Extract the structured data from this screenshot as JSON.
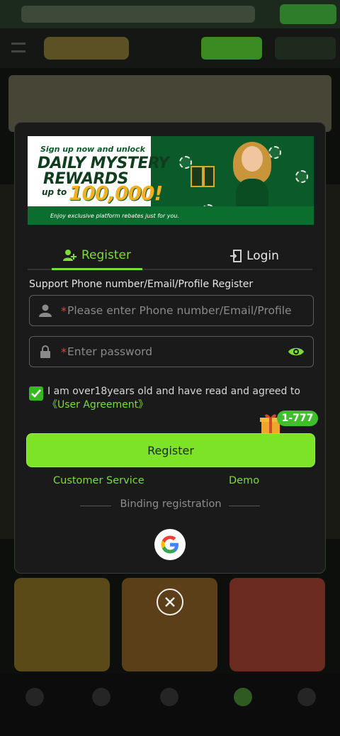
{
  "promo": {
    "line1": "Sign up now and unlock",
    "line2": "DAILY MYSTERY",
    "line3": "REWARDS",
    "line4": "up to",
    "amount": "100,000!",
    "tagline": "Enjoy exclusive platform rebates just for you."
  },
  "tabs": [
    {
      "label": "Register",
      "icon": "add-user-icon",
      "active": true
    },
    {
      "label": "Login",
      "icon": "login-door-icon",
      "active": false
    }
  ],
  "form": {
    "support_text": "Support Phone number/Email/Profile Register",
    "account_placeholder": "Please enter Phone number/Email/Profile",
    "password_placeholder": "Enter password",
    "required_mark": "*",
    "agree_text": "I am over18years old and have read and agreed to",
    "agree_link": "《User Agreement》",
    "agree_checked": true
  },
  "bonus_badge": "1-777",
  "register_button": "Register",
  "links": {
    "customer_service": "Customer Service",
    "demo": "Demo"
  },
  "binding_label": "Binding registration",
  "colors": {
    "accent": "#7ddc3a",
    "button": "#7de326",
    "badge": "#3fbf2b",
    "modal_bg": "#1a1a1a"
  }
}
